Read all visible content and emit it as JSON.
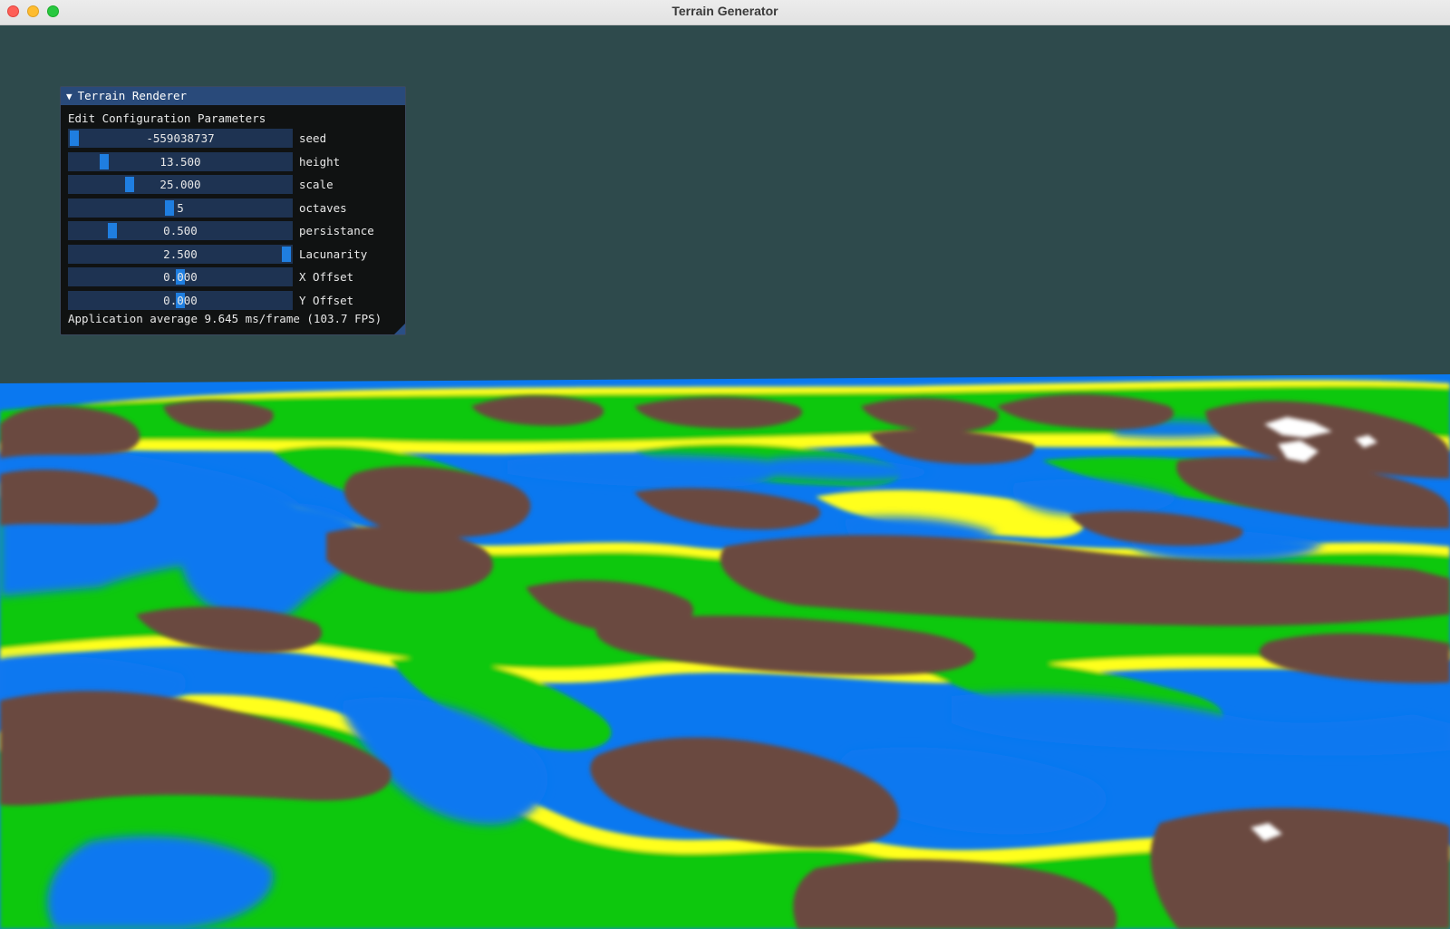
{
  "window": {
    "title": "Terrain Generator"
  },
  "panel": {
    "title": "Terrain Renderer",
    "subtitle": "Edit Configuration Parameters",
    "params": [
      {
        "label": "seed",
        "value": "-559038737",
        "fraction": 0.0
      },
      {
        "label": "height",
        "value": "13.500",
        "fraction": 0.14
      },
      {
        "label": "scale",
        "value": "25.000",
        "fraction": 0.26
      },
      {
        "label": "octaves",
        "value": "5",
        "fraction": 0.45
      },
      {
        "label": "persistance",
        "value": "0.500",
        "fraction": 0.18
      },
      {
        "label": "Lacunarity",
        "value": "2.500",
        "fraction": 1.0
      },
      {
        "label": "X Offset",
        "value": "0.000",
        "fraction": 0.5
      },
      {
        "label": "Y Offset",
        "value": "0.000",
        "fraction": 0.5
      }
    ],
    "fps_text": "Application average 9.645 ms/frame (103.7 FPS)"
  },
  "colors": {
    "background": "#2e4a4c",
    "water": "#0a78f0",
    "sand": "#ffff1e",
    "grass": "#10c810",
    "mountain": "#6b4840",
    "snow": "#ffffff",
    "slider_frame": "#1e3352",
    "slider_grab": "#1f7ee0",
    "title_bar": "#294a7a"
  }
}
